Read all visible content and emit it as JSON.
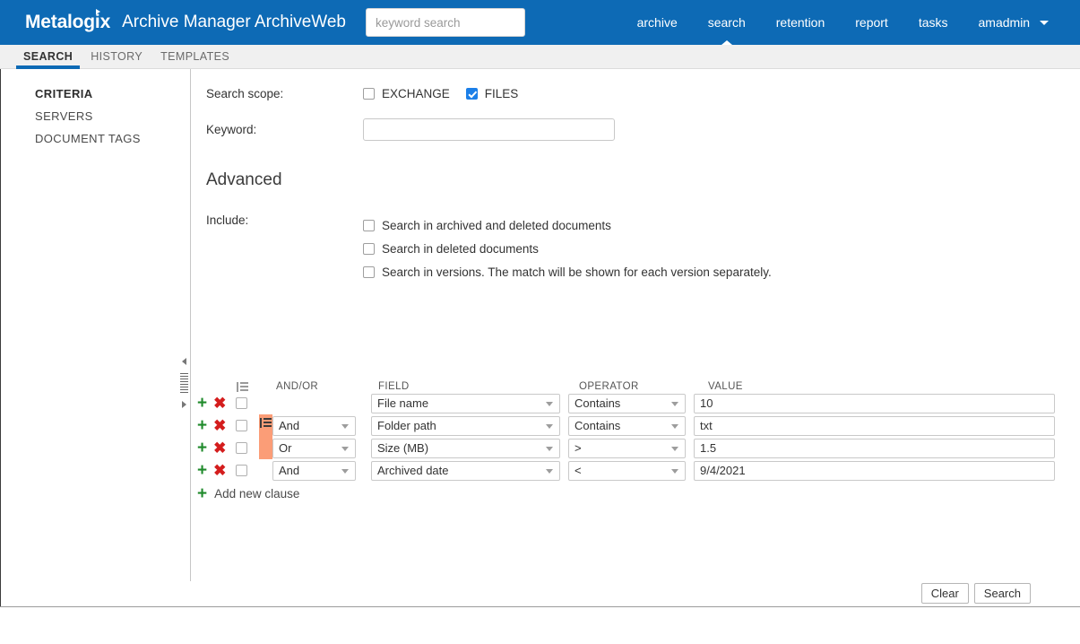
{
  "header": {
    "brand": "Metalogix",
    "app_title": "Archive Manager ArchiveWeb",
    "search_placeholder": "keyword search",
    "search_value": "",
    "accent_color": "#0d6ab5",
    "nav": [
      {
        "label": "archive",
        "active": false
      },
      {
        "label": "search",
        "active": true
      },
      {
        "label": "retention",
        "active": false
      },
      {
        "label": "report",
        "active": false
      },
      {
        "label": "tasks",
        "active": false
      },
      {
        "label": "amadmin",
        "active": false,
        "has_caret": true
      }
    ]
  },
  "tabs": [
    {
      "label": "SEARCH",
      "active": true
    },
    {
      "label": "HISTORY",
      "active": false
    },
    {
      "label": "TEMPLATES",
      "active": false
    }
  ],
  "sidebar": {
    "items": [
      {
        "label": "CRITERIA",
        "active": true
      },
      {
        "label": "SERVERS",
        "active": false
      },
      {
        "label": "DOCUMENT TAGS",
        "active": false
      }
    ]
  },
  "form": {
    "scope_label": "Search scope:",
    "scope_options": [
      {
        "label": "EXCHANGE",
        "checked": false
      },
      {
        "label": "FILES",
        "checked": true
      }
    ],
    "keyword_label": "Keyword:",
    "keyword_value": "",
    "keyword_placeholder": "",
    "advanced_heading": "Advanced",
    "include_label": "Include:",
    "include_options": [
      {
        "label": "Search in archived and deleted documents",
        "checked": false
      },
      {
        "label": "Search in deleted documents",
        "checked": false
      },
      {
        "label": "Search in versions. The match will be shown for each version separately.",
        "checked": false
      }
    ]
  },
  "clause_table": {
    "headers": {
      "group": "group-icon",
      "andor": "AND/OR",
      "field": "FIELD",
      "operator": "OPERATOR",
      "value": "VALUE"
    },
    "group_highlight_color": "#fb9d77",
    "rows": [
      {
        "selected": false,
        "grouped": false,
        "andor": "",
        "field": "File name",
        "operator": "Contains",
        "value": "10"
      },
      {
        "selected": false,
        "grouped": true,
        "group_start": true,
        "andor": "And",
        "field": "Folder path",
        "operator": "Contains",
        "value": "txt"
      },
      {
        "selected": false,
        "grouped": true,
        "group_start": false,
        "andor": "Or",
        "field": "Size (MB)",
        "operator": ">",
        "value": "1.5"
      },
      {
        "selected": false,
        "grouped": false,
        "andor": "And",
        "field": "Archived date",
        "operator": "<",
        "value": "9/4/2021"
      }
    ],
    "add_clause_label": "Add new clause"
  },
  "footer": {
    "clear_label": "Clear",
    "search_label": "Search"
  }
}
